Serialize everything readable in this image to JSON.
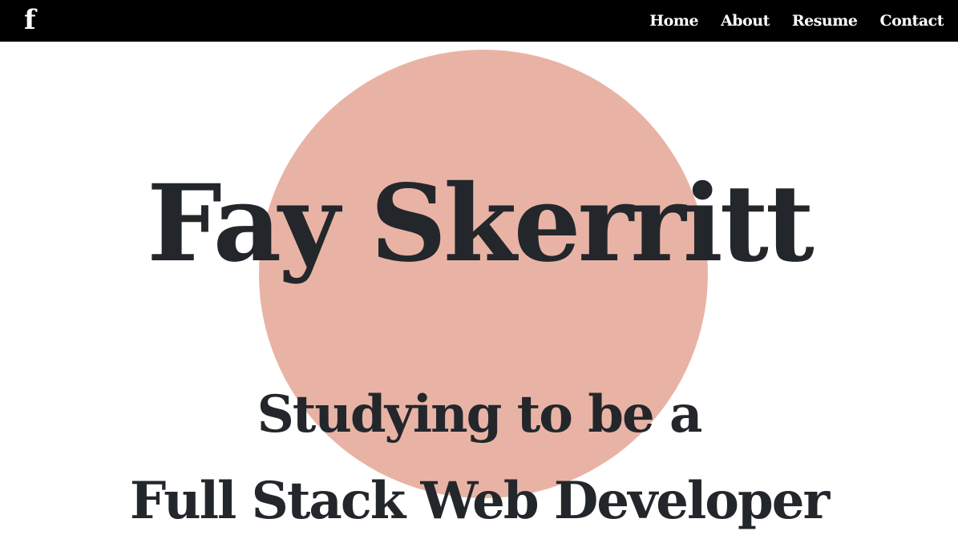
{
  "nav": {
    "logo": "f",
    "links": [
      "Home",
      "About",
      "Resume",
      "Contact"
    ]
  },
  "hero": {
    "name": "Fay Skerritt",
    "tagline_line1": "Studying to be a",
    "tagline_line2": "Full Stack Web Developer"
  },
  "colors": {
    "navbar_bg": "#000000",
    "nav_text": "#ffffff",
    "circle": "#e8b3a5",
    "heading_text": "#23272b",
    "page_bg": "#ffffff"
  }
}
